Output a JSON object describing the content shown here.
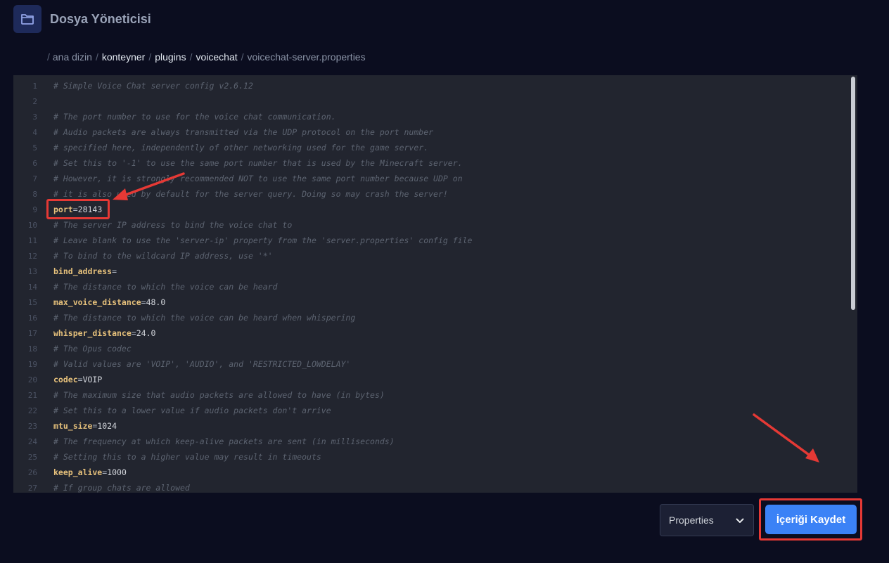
{
  "header": {
    "title": "Dosya Yöneticisi",
    "icon": "folder-icon"
  },
  "breadcrumb": {
    "items": [
      "ana dizin",
      "konteyner",
      "plugins",
      "voicechat",
      "voicechat-server.properties"
    ]
  },
  "editor": {
    "lines": [
      {
        "n": "1",
        "type": "comment",
        "text": "# Simple Voice Chat server config v2.6.12"
      },
      {
        "n": "2",
        "type": "blank",
        "text": ""
      },
      {
        "n": "3",
        "type": "comment",
        "text": "# The port number to use for the voice chat communication."
      },
      {
        "n": "4",
        "type": "comment",
        "text": "# Audio packets are always transmitted via the UDP protocol on the port number"
      },
      {
        "n": "5",
        "type": "comment",
        "text": "# specified here, independently of other networking used for the game server."
      },
      {
        "n": "6",
        "type": "comment",
        "text": "# Set this to '-1' to use the same port number that is used by the Minecraft server."
      },
      {
        "n": "7",
        "type": "comment",
        "text": "# However, it is strongly recommended NOT to use the same port number because UDP on"
      },
      {
        "n": "8",
        "type": "comment",
        "text": "# it is also used by default for the server query. Doing so may crash the server!"
      },
      {
        "n": "9",
        "type": "kv",
        "key": "port",
        "value": "28143"
      },
      {
        "n": "10",
        "type": "comment",
        "text": "# The server IP address to bind the voice chat to"
      },
      {
        "n": "11",
        "type": "comment",
        "text": "# Leave blank to use the 'server-ip' property from the 'server.properties' config file"
      },
      {
        "n": "12",
        "type": "comment",
        "text": "# To bind to the wildcard IP address, use '*'"
      },
      {
        "n": "13",
        "type": "kv",
        "key": "bind_address",
        "value": ""
      },
      {
        "n": "14",
        "type": "comment",
        "text": "# The distance to which the voice can be heard"
      },
      {
        "n": "15",
        "type": "kv",
        "key": "max_voice_distance",
        "value": "48.0"
      },
      {
        "n": "16",
        "type": "comment",
        "text": "# The distance to which the voice can be heard when whispering"
      },
      {
        "n": "17",
        "type": "kv",
        "key": "whisper_distance",
        "value": "24.0"
      },
      {
        "n": "18",
        "type": "comment",
        "text": "# The Opus codec"
      },
      {
        "n": "19",
        "type": "comment",
        "text": "# Valid values are 'VOIP', 'AUDIO', and 'RESTRICTED_LOWDELAY'"
      },
      {
        "n": "20",
        "type": "kv",
        "key": "codec",
        "value": "VOIP"
      },
      {
        "n": "21",
        "type": "comment",
        "text": "# The maximum size that audio packets are allowed to have (in bytes)"
      },
      {
        "n": "22",
        "type": "comment",
        "text": "# Set this to a lower value if audio packets don't arrive"
      },
      {
        "n": "23",
        "type": "kv",
        "key": "mtu_size",
        "value": "1024"
      },
      {
        "n": "24",
        "type": "comment",
        "text": "# The frequency at which keep-alive packets are sent (in milliseconds)"
      },
      {
        "n": "25",
        "type": "comment",
        "text": "# Setting this to a higher value may result in timeouts"
      },
      {
        "n": "26",
        "type": "kv",
        "key": "keep_alive",
        "value": "1000"
      },
      {
        "n": "27",
        "type": "comment",
        "text": "# If group chats are allowed"
      }
    ]
  },
  "footer": {
    "language_select": {
      "value": "Properties"
    },
    "save_label": "İçeriği Kaydet"
  },
  "colors": {
    "accent": "#3b82f6",
    "annotation": "#e53935"
  }
}
